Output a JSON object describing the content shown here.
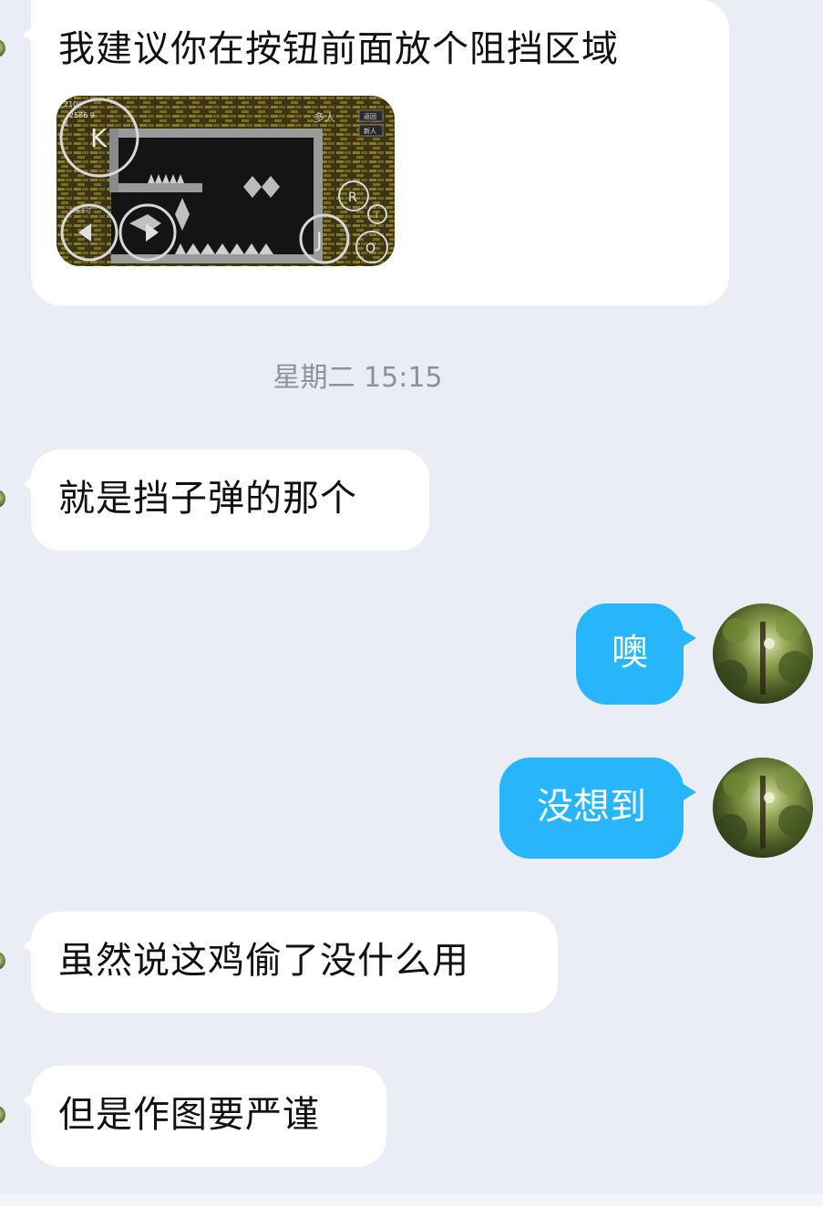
{
  "messages": {
    "m1": {
      "text": "我建议你在按钮前面放个阻挡区域"
    },
    "m2": {
      "text": "就是挡子弹的那个"
    },
    "m3": {
      "text": "噢"
    },
    "m4": {
      "text": "没想到"
    },
    "m5": {
      "text": "虽然说这鸡偷了没什么用"
    },
    "m6": {
      "text": "但是作图要严谨"
    }
  },
  "timestamp": "星期二 15:15",
  "game_screenshot": {
    "hud_top": "210",
    "hud_score": "2586 9",
    "hud_small": "4",
    "mode_label": "多人",
    "menu_btn_1": "返回",
    "menu_btn_2": "新人",
    "left_note": "试着卡过",
    "btn_k": "K",
    "btn_j": "J",
    "btn_r": "R",
    "btn_o": "O",
    "btn_i": "i"
  },
  "colors": {
    "background": "#eaedf3",
    "incoming_bubble": "#ffffff",
    "outgoing_bubble": "#27b6fa",
    "timestamp_text": "#8c929c"
  },
  "icons": {
    "partner_avatar": "avatar-partial",
    "self_avatar": "forest-avatar"
  }
}
